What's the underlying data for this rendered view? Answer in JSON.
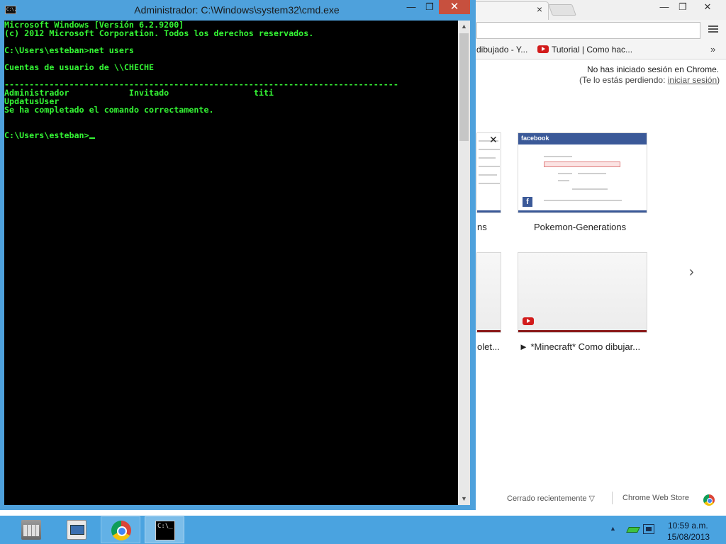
{
  "chrome": {
    "tab_close": "×",
    "window_min": "—",
    "window_max": "❐",
    "window_close": "✕",
    "bookmarks": [
      {
        "label": "dibujado - Y..."
      },
      {
        "label": "Tutorial | Como hac..."
      }
    ],
    "bookmarks_more": "»",
    "signin_line1": "No has iniciado sesión en Chrome.",
    "signin_line2_prefix": "(Te lo estás perdiendo: ",
    "signin_link": "iniciar sesión",
    "signin_line2_suffix": ")",
    "thumbnails": [
      {
        "caption": "ns"
      },
      {
        "caption": "Pokemon-Generations",
        "bar_label": "facebook"
      },
      {
        "caption": "olet..."
      },
      {
        "caption": "► *Minecraft* Como dibujar..."
      }
    ],
    "thumb_close": "✕",
    "next_arrow": "›",
    "recently_closed": "Cerrado recientemente ▽",
    "web_store": "Chrome Web Store"
  },
  "cmd": {
    "title": "Administrador: C:\\Windows\\system32\\cmd.exe",
    "icon_text": "C:\\.",
    "min": "—",
    "max": "❐",
    "close": "✕",
    "lines": [
      "Microsoft Windows [Versión 6.2.9200]",
      "(c) 2012 Microsoft Corporation. Todos los derechos reservados.",
      "",
      "C:\\Users\\esteban>net users",
      "",
      "Cuentas de usuario de \\\\CHECHE",
      "",
      "-------------------------------------------------------------------------------",
      "Administrador            Invitado                 titi",
      "UpdatusUser",
      "Se ha completado el comando correctamente.",
      "",
      "",
      "C:\\Users\\esteban>"
    ],
    "scroll_up": "▲",
    "scroll_down": "▼"
  },
  "taskbar": {
    "apps": [
      {
        "name": "file-explorer",
        "state": "idle"
      },
      {
        "name": "performance-monitor",
        "state": "idle"
      },
      {
        "name": "google-chrome",
        "state": "open"
      },
      {
        "name": "command-prompt",
        "state": "active"
      }
    ],
    "cmd_icon_text": "C:\\_",
    "tray_arrow": "▲",
    "time": "10:59 a.m.",
    "date": "15/08/2013"
  }
}
